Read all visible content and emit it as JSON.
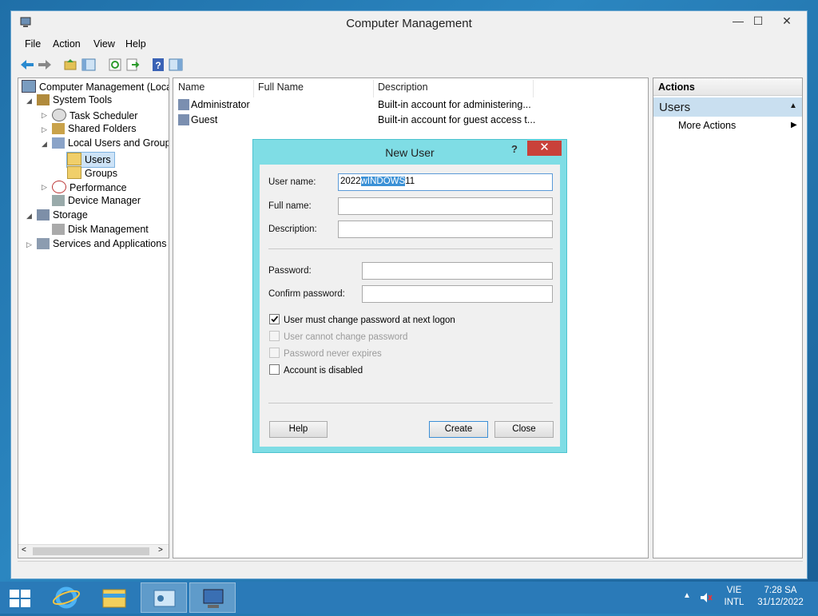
{
  "window": {
    "title": "Computer Management",
    "controls": {
      "minimize": "—",
      "maximize": "☐",
      "close": "✕"
    }
  },
  "menu": [
    "File",
    "Action",
    "View",
    "Help"
  ],
  "tree": {
    "root": "Computer Management (Local",
    "system_tools": "System Tools",
    "task_scheduler": "Task Scheduler",
    "shared_folders": "Shared Folders",
    "local_users": "Local Users and Groups",
    "users": "Users",
    "groups": "Groups",
    "performance": "Performance",
    "device_manager": "Device Manager",
    "storage": "Storage",
    "disk_management": "Disk Management",
    "services": "Services and Applications"
  },
  "list": {
    "columns": [
      "Name",
      "Full Name",
      "Description"
    ],
    "rows": [
      {
        "name": "Administrator",
        "full_name": "",
        "description": "Built-in account for administering..."
      },
      {
        "name": "Guest",
        "full_name": "",
        "description": "Built-in account for guest access t..."
      }
    ]
  },
  "actions": {
    "header": "Actions",
    "section": "Users",
    "more": "More Actions"
  },
  "dialog": {
    "title": "New User",
    "help_glyph": "?",
    "close_glyph": "✕",
    "labels": {
      "user_name": "User name:",
      "full_name": "Full name:",
      "description": "Description:",
      "password": "Password:",
      "confirm": "Confirm password:"
    },
    "values": {
      "user_name_prefix": "2022",
      "user_name_selected": "wINDOWS",
      "user_name_suffix": "11",
      "full_name": "",
      "description": "",
      "password": "",
      "confirm": ""
    },
    "checkboxes": {
      "must_change": "User must change password at next logon",
      "cannot_change": "User cannot change password",
      "never_expires": "Password never expires",
      "disabled": "Account is disabled"
    },
    "buttons": {
      "help": "Help",
      "create": "Create",
      "close": "Close"
    }
  },
  "taskbar": {
    "lang_top": "VIE",
    "lang_bottom": "INTL",
    "time": "7:28 SA",
    "date": "31/12/2022"
  },
  "colors": {
    "accent": "#3b91d6",
    "dialog_frame": "#7fdde5",
    "close_red": "#c9413a",
    "taskbar": "#2a7ab8"
  }
}
